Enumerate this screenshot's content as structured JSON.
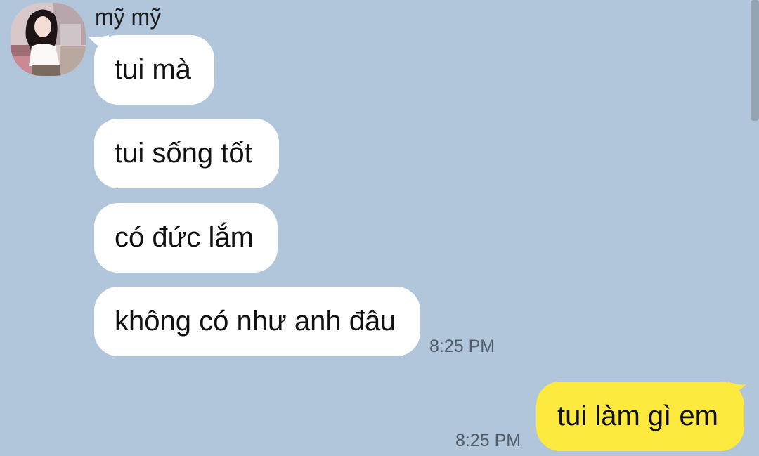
{
  "conversation": {
    "contact_name": "mỹ mỹ",
    "avatar_icon": "profile-photo",
    "incoming": [
      {
        "text": "tui mà"
      },
      {
        "text": "tui sống tốt"
      },
      {
        "text": "có đức lắm"
      },
      {
        "text": "không có như anh đâu"
      }
    ],
    "incoming_time": "8:25 PM",
    "outgoing": [
      {
        "text": "tui làm gì em"
      }
    ],
    "outgoing_time": "8:25 PM"
  },
  "colors": {
    "background": "#b1c6db",
    "incoming_bubble": "#ffffff",
    "outgoing_bubble": "#fee93f",
    "timestamp": "#525c68"
  }
}
